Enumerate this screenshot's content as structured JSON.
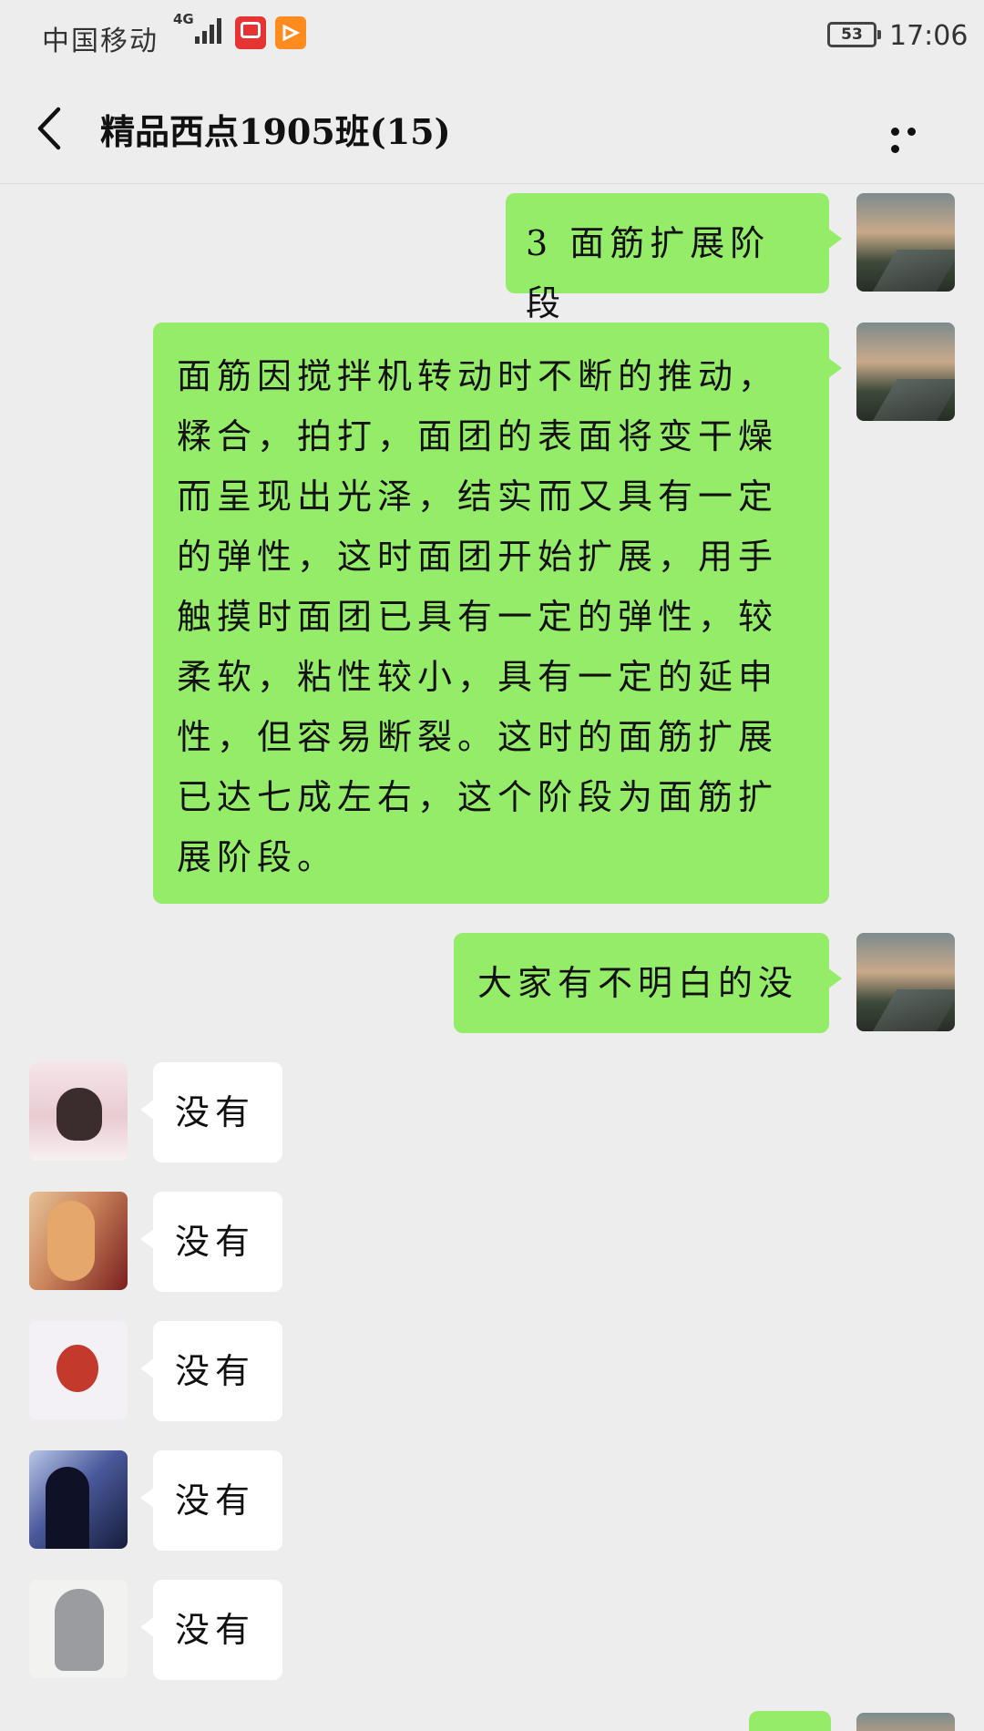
{
  "status_bar": {
    "carrier": "中国移动",
    "network": "4G",
    "battery": "53",
    "time": "17:06",
    "icons": [
      "signal-icon",
      "video-app-icon",
      "player-app-icon"
    ]
  },
  "header": {
    "title": "精品西点1905班(15)",
    "back_icon": "chevron-left-icon",
    "more_icon": "more-dots-icon"
  },
  "messages": [
    {
      "side": "out",
      "text": "3 面筋扩展阶段"
    },
    {
      "side": "out",
      "lines": [
        "面筋因搅拌机转动时不断的推动，",
        "糅合，拍打，面团的表面将变干燥",
        "而呈现出光泽，结实而又具有一定",
        "的弹性，这时面团开始扩展，用手",
        "触摸时面团已具有一定的弹性，较",
        "柔软，粘性较小，具有一定的延申",
        "性，但容易断裂。这时的面筋扩展",
        "已达七成左右，这个阶段为面筋扩",
        "展阶段。"
      ]
    },
    {
      "side": "out",
      "text": "大家有不明白的没"
    },
    {
      "side": "in",
      "text": "没有"
    },
    {
      "side": "in",
      "text": "没有"
    },
    {
      "side": "in",
      "text": "没有"
    },
    {
      "side": "in",
      "text": "没有"
    },
    {
      "side": "in",
      "text": "没有"
    }
  ],
  "colors": {
    "background": "#ededed",
    "outgoing_bubble": "#95ec69",
    "incoming_bubble": "#ffffff"
  }
}
